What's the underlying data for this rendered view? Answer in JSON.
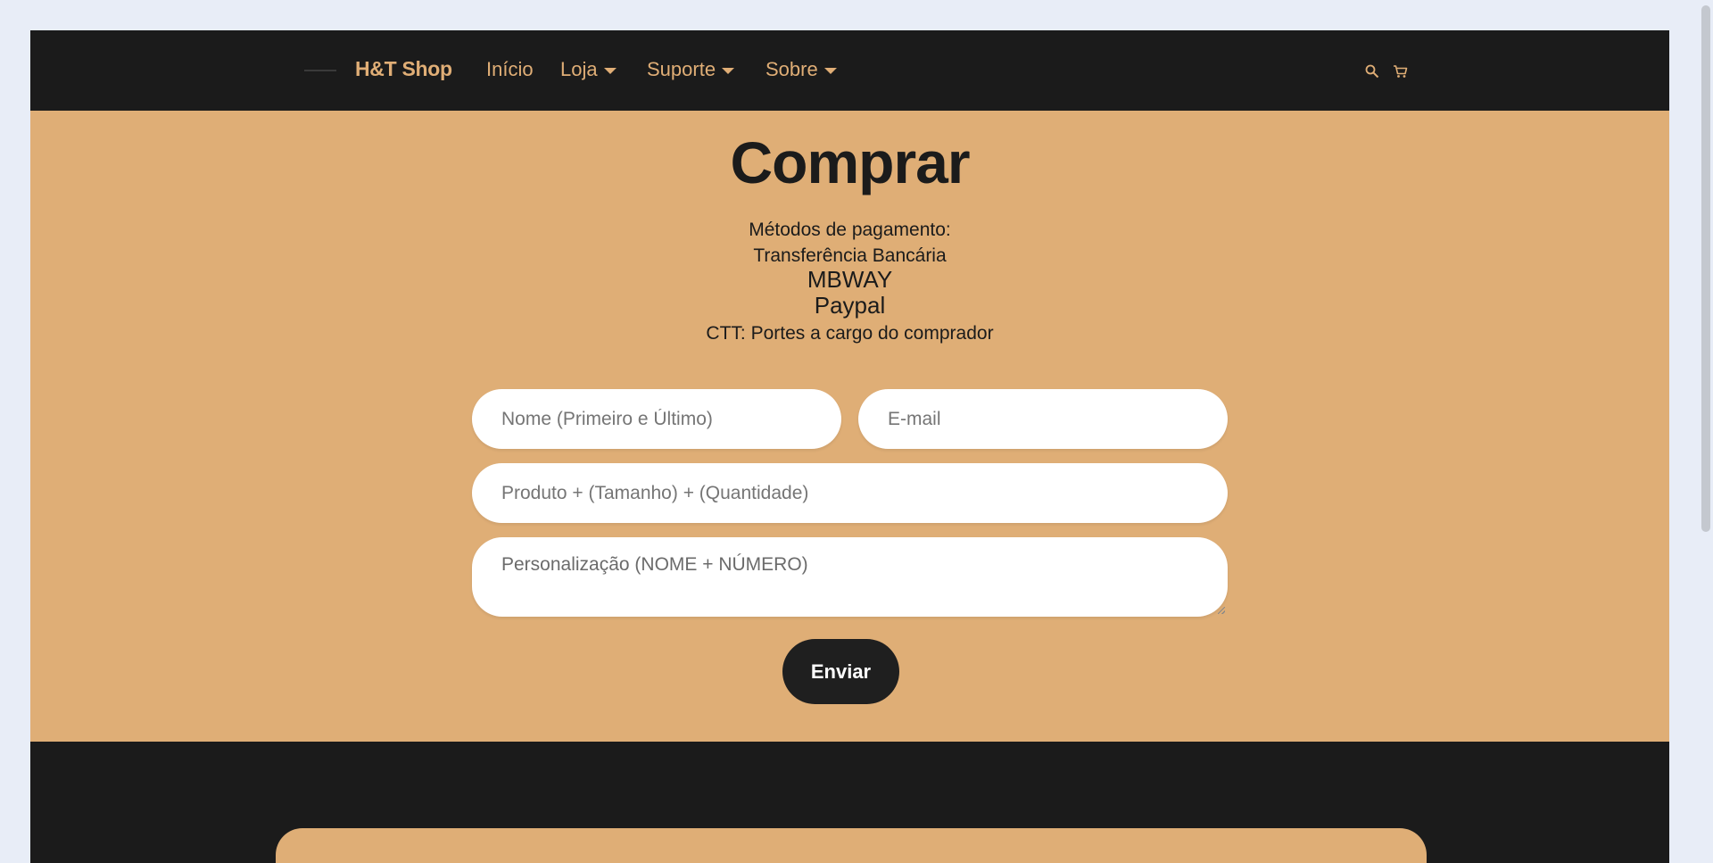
{
  "nav": {
    "brand": "H&T Shop",
    "items": [
      {
        "label": "Início",
        "dropdown": false
      },
      {
        "label": "Loja",
        "dropdown": true
      },
      {
        "label": "Suporte",
        "dropdown": true
      },
      {
        "label": "Sobre",
        "dropdown": true
      }
    ],
    "icons": [
      "search-icon",
      "cart-icon"
    ],
    "accent_color": "#e0ae76",
    "bg_color": "#1b1b1b"
  },
  "main": {
    "title": "Comprar",
    "payment_heading": "Métodos de pagamento:",
    "payment_methods": [
      "Transferência Bancária",
      "MBWAY",
      "Paypal"
    ],
    "shipping": "CTT: Portes a cargo do comprador",
    "bg_color": "#dfae76"
  },
  "form": {
    "name_placeholder": "Nome (Primeiro e Último)",
    "email_placeholder": "E-mail",
    "product_placeholder": "Produto + (Tamanho) + (Quantidade)",
    "custom_placeholder": "Personalização (NOME + NÚMERO)",
    "submit_label": "Enviar"
  }
}
